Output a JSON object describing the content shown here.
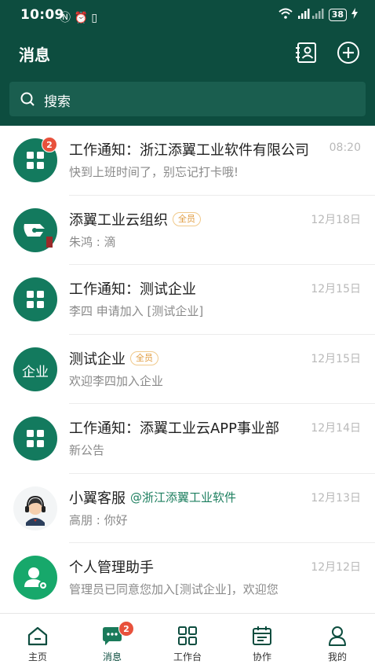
{
  "status_bar": {
    "time": "10:09",
    "battery": "38"
  },
  "header": {
    "title": "消息"
  },
  "search": {
    "placeholder": "搜索"
  },
  "conversations": [
    {
      "title": "工作通知：浙江添翼工业软件有限公司",
      "subtitle": "快到上班时间了，别忘记打卡哦!",
      "time": "08:20",
      "badge": "2",
      "avatar": "grid-icon"
    },
    {
      "title": "添翼工业云组织",
      "tag": "全员",
      "subtitle": "朱鸿 : 滴",
      "time": "12月18日",
      "avatar": "org-logo-icon"
    },
    {
      "title": "工作通知：测试企业",
      "subtitle": "李四 申请加入 [测试企业]",
      "time": "12月15日",
      "avatar": "grid-icon"
    },
    {
      "title": "测试企业",
      "tag": "全员",
      "avatar_text": "企业",
      "subtitle": "欢迎李四加入企业",
      "time": "12月15日"
    },
    {
      "title": "工作通知：添翼工业云APP事业部",
      "subtitle": "新公告",
      "time": "12月14日",
      "avatar": "grid-icon"
    },
    {
      "title": "小翼客服",
      "mention": "@浙江添翼工业软件",
      "subtitle": "高朋 : 你好",
      "time": "12月13日",
      "avatar": "support-agent-icon"
    },
    {
      "title": "个人管理助手",
      "subtitle": "管理员已同意您加入[测试企业]，欢迎您",
      "time": "12月12日",
      "avatar": "user-gear-icon"
    }
  ],
  "tabs": [
    {
      "label": "主页",
      "icon": "home-icon"
    },
    {
      "label": "消息",
      "icon": "chat-icon",
      "badge": "2",
      "active": true
    },
    {
      "label": "工作台",
      "icon": "apps-icon"
    },
    {
      "label": "协作",
      "icon": "calendar-icon"
    },
    {
      "label": "我的",
      "icon": "profile-icon"
    }
  ],
  "colors": {
    "primary": "#0d4d3f",
    "accent": "#137a5e",
    "badge": "#e8513c"
  }
}
